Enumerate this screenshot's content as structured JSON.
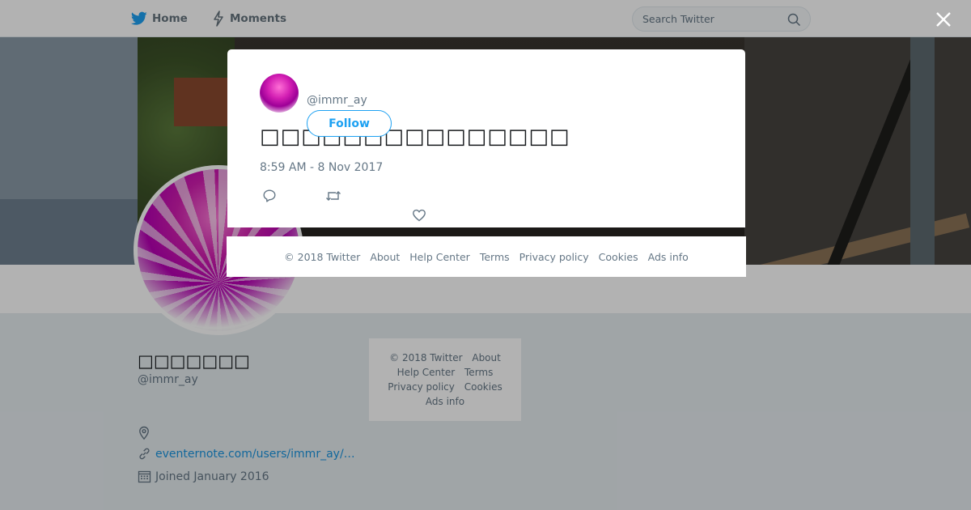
{
  "nav": {
    "home_label": "Home",
    "moments_label": "Moments",
    "search_placeholder": "Search Twitter"
  },
  "profile": {
    "name": "□□□□□□□",
    "handle": "@immr_ay",
    "location": "",
    "url": "eventernote.com/users/immr_ay/…",
    "joined": "Joined January 2016"
  },
  "side_footer": {
    "copyright": "© 2018 Twitter",
    "about": "About",
    "help_center": "Help Center",
    "terms": "Terms",
    "privacy": "Privacy policy",
    "cookies": "Cookies",
    "ads_info": "Ads info"
  },
  "modal": {
    "handle": "@immr_ay",
    "follow_label": "Follow",
    "tweet_text": "□□□□□□□□□□□□□□□",
    "timestamp": "8:59 AM - 8 Nov 2017"
  },
  "modal_footer": {
    "copyright": "© 2018 Twitter",
    "about": "About",
    "help_center": "Help Center",
    "terms": "Terms",
    "privacy": "Privacy policy",
    "cookies": "Cookies",
    "ads_info": "Ads info"
  },
  "icons": {
    "home": "twitter-bird-icon",
    "moments": "lightning-icon",
    "search": "search-icon",
    "close": "close-icon",
    "location": "location-pin-icon",
    "link": "link-icon",
    "calendar": "calendar-icon",
    "reply": "reply-icon",
    "retweet": "retweet-icon",
    "like": "heart-icon"
  },
  "colors": {
    "brand_blue": "#1da1f2",
    "link_blue": "#1b95e0",
    "text_gray": "#657786"
  }
}
